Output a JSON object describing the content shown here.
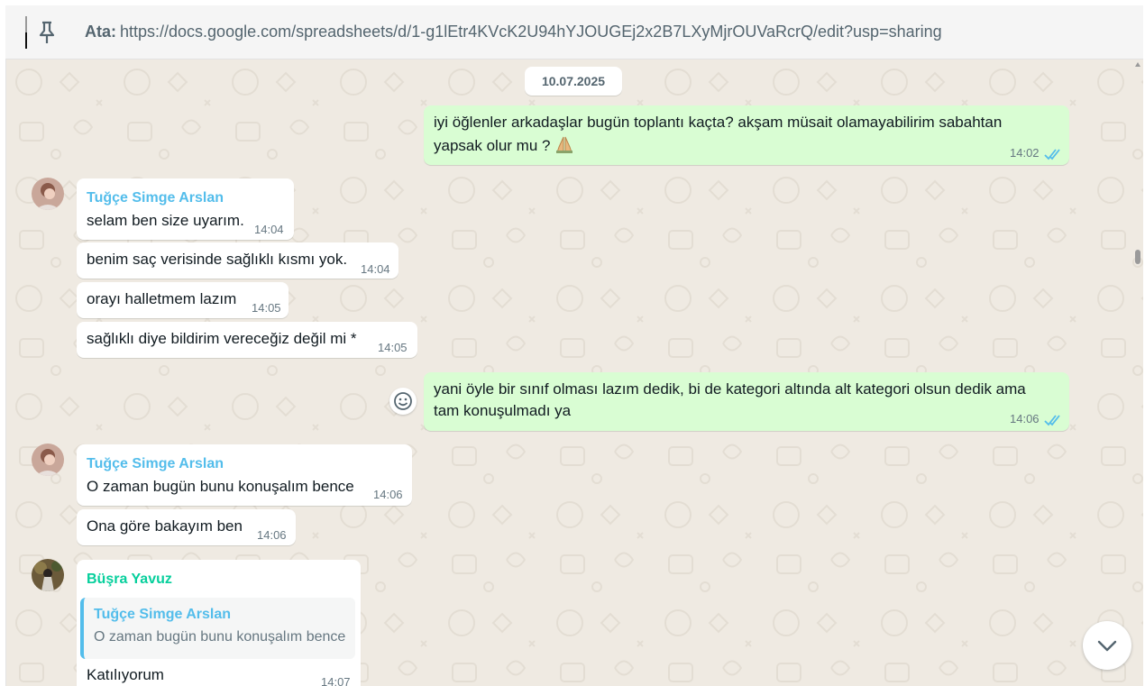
{
  "pinned": {
    "label": "Ata:",
    "url": "https://docs.google.com/spreadsheets/d/1-g1lEtr4KVcK2U94hYJOUGEj2x2B7LXyMjrOUVaRcrQ/edit?usp=sharing",
    "icon": "pin-icon"
  },
  "chat": {
    "date": "10.07.2025",
    "messages": [
      {
        "direction": "out",
        "line1": "iyi öğlenler arkadaşlar bugün toplantı kaçta? akşam müsait olamayabilirim sabahtan",
        "line2": "yapsak olur mu ?",
        "emoji": "🙏",
        "time": "14:02",
        "status": "read"
      },
      {
        "direction": "in",
        "sender": "Tuğçe Simge Arslan",
        "text": "selam ben size uyarım.",
        "time": "14:04"
      },
      {
        "direction": "in",
        "text": "benim saç verisinde sağlıklı kısmı yok.",
        "time": "14:04"
      },
      {
        "direction": "in",
        "text": "orayı halletmem lazım",
        "time": "14:05"
      },
      {
        "direction": "in",
        "text": "sağlıklı diye bildirim vereceğiz değil mi *",
        "time": "14:05"
      },
      {
        "direction": "out",
        "line1": "yani öyle bir sınıf olması lazım dedik, bi de kategori altında alt kategori olsun dedik ama",
        "line2": "tam konuşulmadı ya",
        "time": "14:06",
        "status": "read"
      },
      {
        "direction": "in",
        "sender": "Tuğçe Simge Arslan",
        "text": "O zaman bugün bunu konuşalım bence",
        "time": "14:06"
      },
      {
        "direction": "in",
        "text": "Ona göre bakayım ben",
        "time": "14:06"
      },
      {
        "direction": "in",
        "sender": "Büşra Yavuz",
        "quote": {
          "sender": "Tuğçe Simge Arslan",
          "text": "O zaman bugün bunu konuşalım bence"
        },
        "text": "Katılıyorum",
        "time": "14:07"
      }
    ]
  },
  "colors": {
    "outgoing_bubble": "#d9fdd3",
    "incoming_bubble": "#ffffff",
    "chat_background": "#efeae2",
    "sender_blue": "#53bdeb",
    "sender_green": "#06cf9c",
    "read_tick": "#53bdeb"
  },
  "icons": [
    "pin-icon",
    "double-check-icon",
    "emoji-reaction-icon",
    "chevron-down-icon",
    "praying-hands-emoji"
  ]
}
